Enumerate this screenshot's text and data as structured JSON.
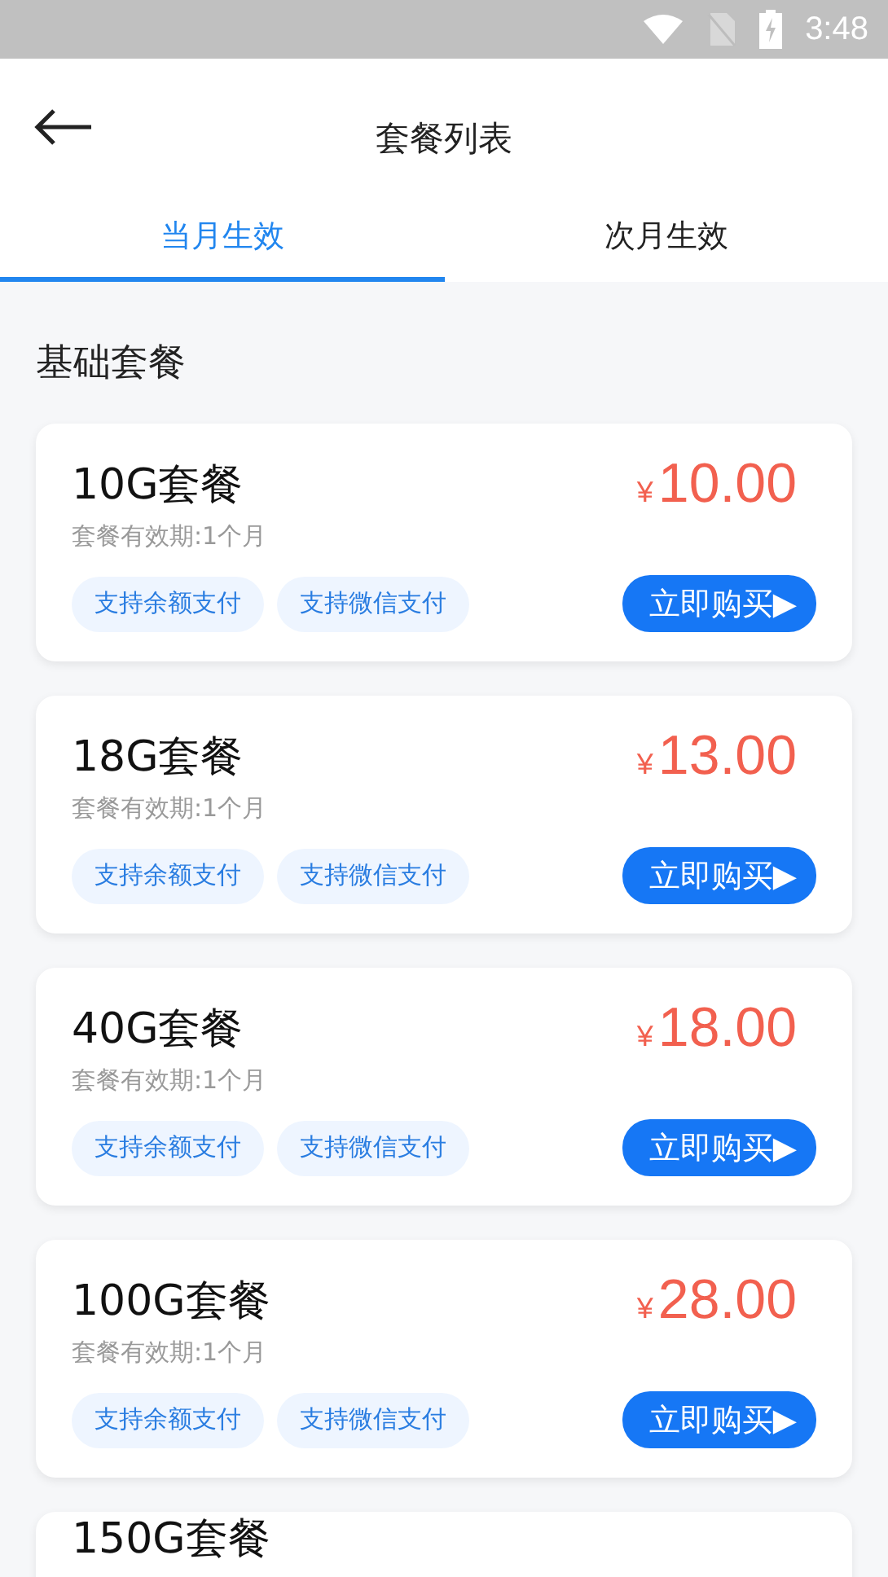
{
  "status_bar": {
    "time": "3:48"
  },
  "header": {
    "title": "套餐列表"
  },
  "tabs": [
    {
      "label": "当月生效",
      "selected": true
    },
    {
      "label": "次月生效",
      "selected": false
    }
  ],
  "section_title": "基础套餐",
  "plans": [
    {
      "name": "10G套餐",
      "validity": "套餐有效期:1个月",
      "currency": "¥",
      "amount": "10.00",
      "tags": [
        "支持余额支付",
        "支持微信支付"
      ],
      "buy": "立即购买▶"
    },
    {
      "name": "18G套餐",
      "validity": "套餐有效期:1个月",
      "currency": "¥",
      "amount": "13.00",
      "tags": [
        "支持余额支付",
        "支持微信支付"
      ],
      "buy": "立即购买▶"
    },
    {
      "name": "40G套餐",
      "validity": "套餐有效期:1个月",
      "currency": "¥",
      "amount": "18.00",
      "tags": [
        "支持余额支付",
        "支持微信支付"
      ],
      "buy": "立即购买▶"
    },
    {
      "name": "100G套餐",
      "validity": "套餐有效期:1个月",
      "currency": "¥",
      "amount": "28.00",
      "tags": [
        "支持余额支付",
        "支持微信支付"
      ],
      "buy": "立即购买▶"
    },
    {
      "name": "150G套餐"
    }
  ]
}
